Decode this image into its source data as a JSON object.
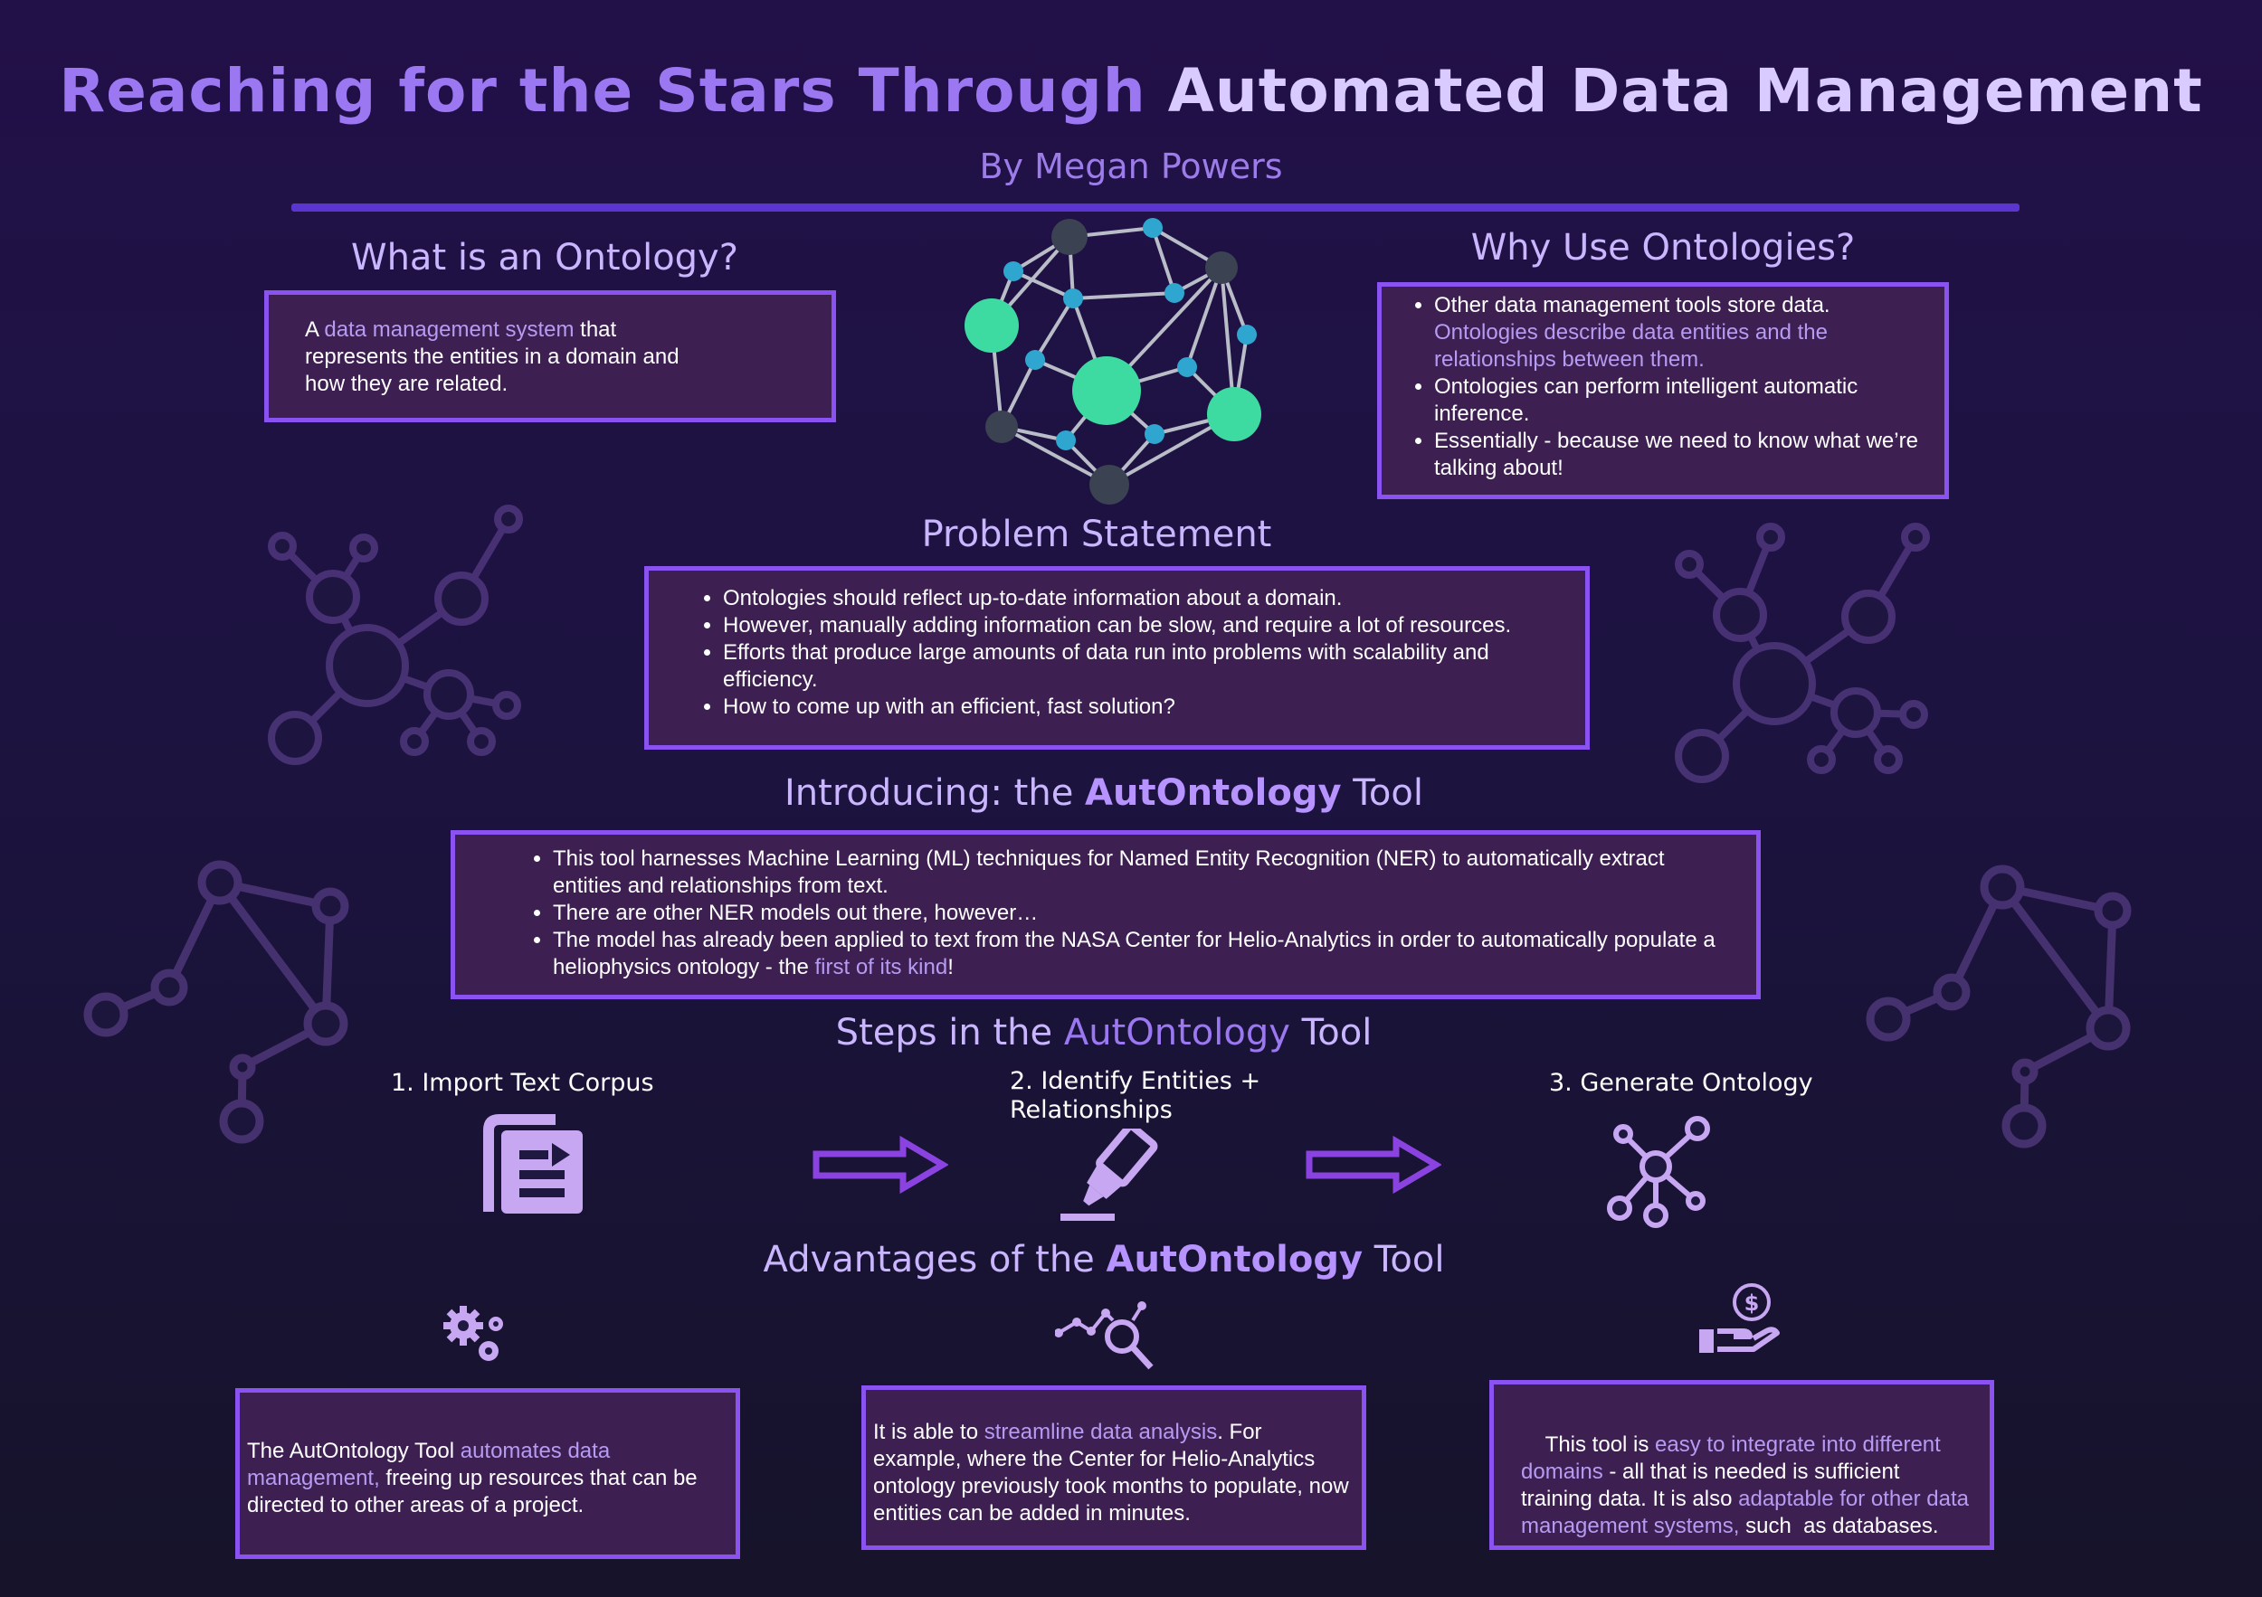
{
  "header": {
    "title_part1": "Reaching for the Stars Through",
    "title_part2": "Automated Data Management",
    "author": "By Megan Powers"
  },
  "ontology_def": {
    "heading": "What is an Ontology?",
    "text_pre": "A ",
    "text_hl": "data management system",
    "text_post": " that represents the entities in a domain and how they are related."
  },
  "why_use": {
    "heading": "Why Use Ontologies?",
    "item1": "Other data management tools store data.",
    "item1_hl": "Ontologies describe data entities and the relationships between them.",
    "item2": "Ontologies can perform intelligent automatic inference.",
    "item3": "Essentially - because we need to know what we’re talking about!"
  },
  "problem": {
    "heading": "Problem Statement",
    "items": [
      "Ontologies should reflect up-to-date information about a domain.",
      "However, manually adding information can be slow, and require a lot of resources.",
      "Efforts that produce large amounts of data run into problems with scalability and efficiency.",
      "How to come up with an efficient, fast solution?"
    ]
  },
  "intro": {
    "heading_pre": "Introducing: the ",
    "heading_bold": "AutOntology",
    "heading_post": " Tool",
    "item1": "This tool harnesses Machine Learning (ML) techniques for Named Entity Recognition (NER) to automatically extract entities and relationships from text.",
    "item2": "There are other NER models out there, however…",
    "item3_pre": "The model has already been applied to text from the NASA Center for Helio-Analytics in order to automatically populate a heliophysics ontology - the ",
    "item3_hl": "first of its kind",
    "item3_post": "!"
  },
  "steps": {
    "heading_pre": "Steps in the ",
    "heading_hl": "AutOntology",
    "heading_post": " Tool",
    "step1": "1. Import Text Corpus",
    "step2": "2. Identify Entities + Relationships",
    "step3": "3. Generate Ontology"
  },
  "advantages": {
    "heading_pre": "Advantages of the ",
    "heading_bold": "AutOntology",
    "heading_post": " Tool",
    "adv1_pre": "The AutOntology Tool ",
    "adv1_hl": "automates data management,",
    "adv1_post": " freeing up resources that can be directed to other areas of a project.",
    "adv2_pre": "It is able to ",
    "adv2_hl": "streamline data analysis",
    "adv2_post": ". For example, where the Center for Helio-Analytics ontology previously took months to populate, now entities can be added in minutes.",
    "adv3_pre": "This tool is ",
    "adv3_hl1": "easy to integrate into different domains",
    "adv3_mid": " - all that is needed is sufficient  training data. It is also ",
    "adv3_hl2": "adaptable for other data management systems,",
    "adv3_post": " such  as databases."
  },
  "colors": {
    "accent": "#8a52f0",
    "box_fill": "#3d1f52",
    "highlight_text": "#b69bf2",
    "node_green": "#3ddba1",
    "node_blue": "#2fa6cf",
    "node_dark": "#3b4252"
  },
  "icons": {
    "network": "network-graph-icon",
    "document": "document-icon",
    "arrow": "right-arrow-icon",
    "highlighter": "highlighter-icon",
    "hub": "hub-network-icon",
    "gears": "gears-icon",
    "analytics": "analytics-search-icon",
    "money_hand": "money-hand-icon"
  }
}
